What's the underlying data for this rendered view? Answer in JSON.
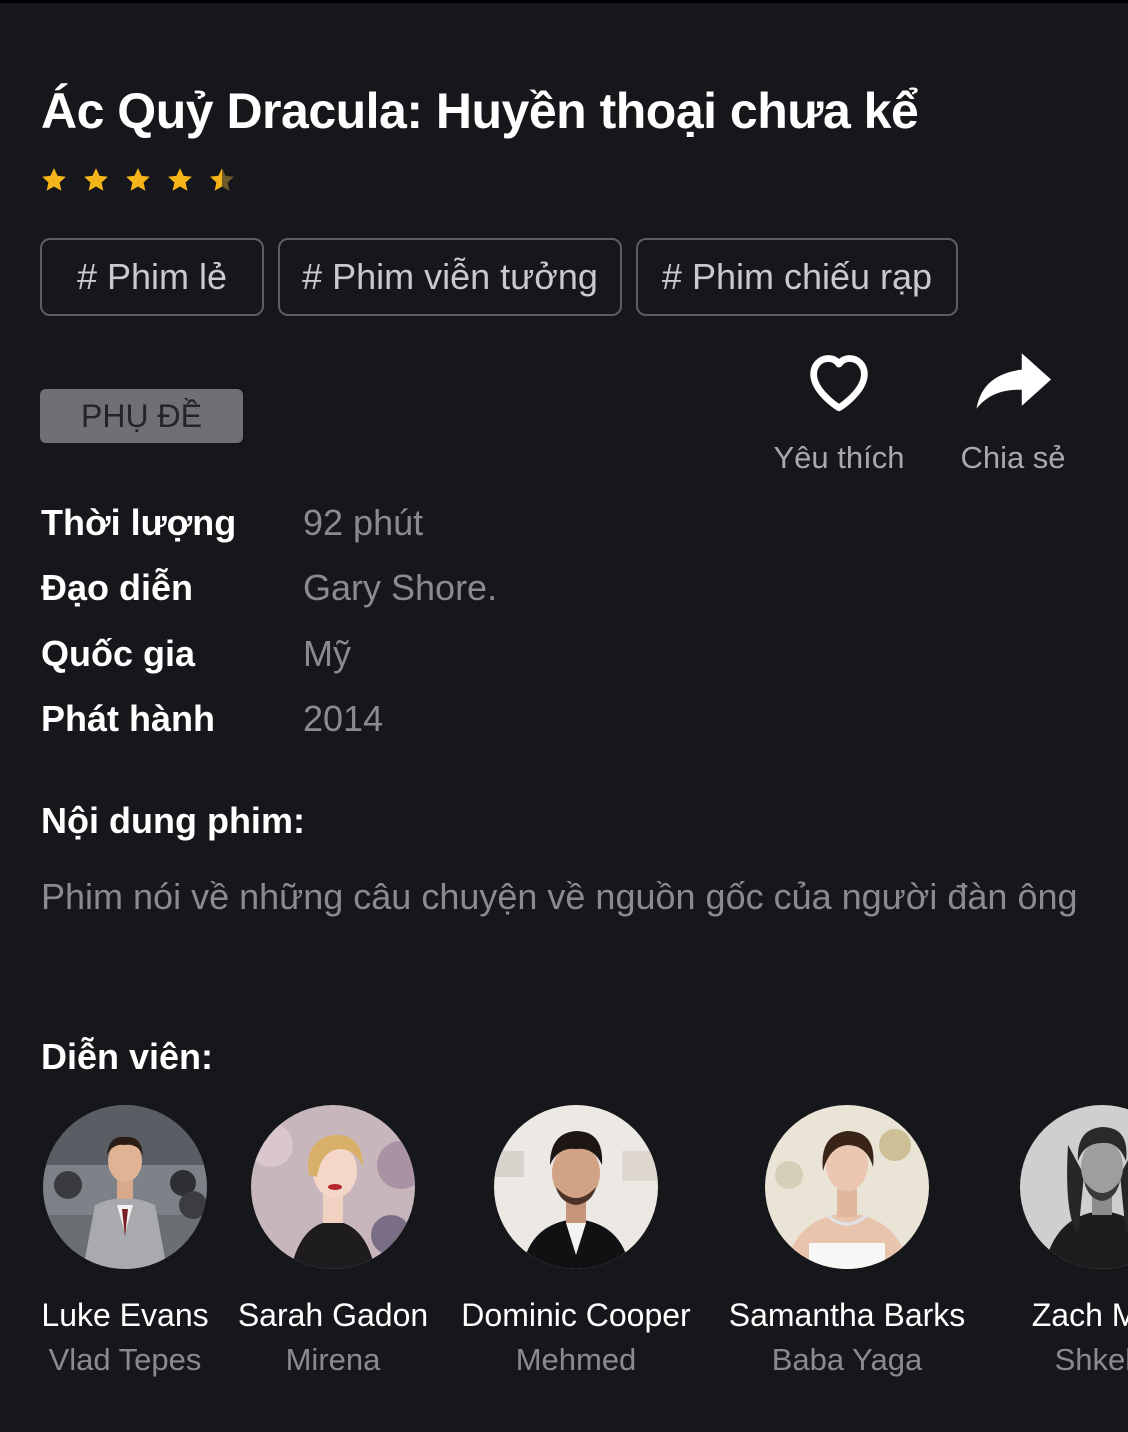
{
  "movie": {
    "title": "Ác Quỷ Dracula: Huyền thoại chưa kể",
    "rating_stars": 4.5,
    "rating_max": 5,
    "star_color": "#f5b417",
    "tags": [
      "# Phim lẻ",
      "# Phim viễn tưởng",
      "# Phim chiếu rạp"
    ],
    "badge": "PHỤ ĐỀ"
  },
  "actions": {
    "like_label": "Yêu thích",
    "like_icon": "heart-icon",
    "share_label": "Chia sẻ",
    "share_icon": "share-arrow-icon"
  },
  "info": [
    {
      "label": "Thời lượng",
      "value": "92 phút"
    },
    {
      "label": "Đạo diễn",
      "value": "Gary Shore."
    },
    {
      "label": "Quốc gia",
      "value": "Mỹ"
    },
    {
      "label": "Phát hành",
      "value": "2014"
    }
  ],
  "plot": {
    "heading": "Nội dung phim:",
    "text": "Phim nói về những câu chuyện về nguồn gốc của người đàn ông"
  },
  "cast": {
    "heading": "Diễn viên:",
    "members": [
      {
        "name": "Luke Evans",
        "role": "Vlad Tepes"
      },
      {
        "name": "Sarah Gadon",
        "role": "Mirena"
      },
      {
        "name": "Dominic Cooper",
        "role": "Mehmed"
      },
      {
        "name": "Samantha Barks",
        "role": "Baba Yaga"
      },
      {
        "name": "Zach Mcg",
        "role": "Shkelg"
      }
    ]
  }
}
